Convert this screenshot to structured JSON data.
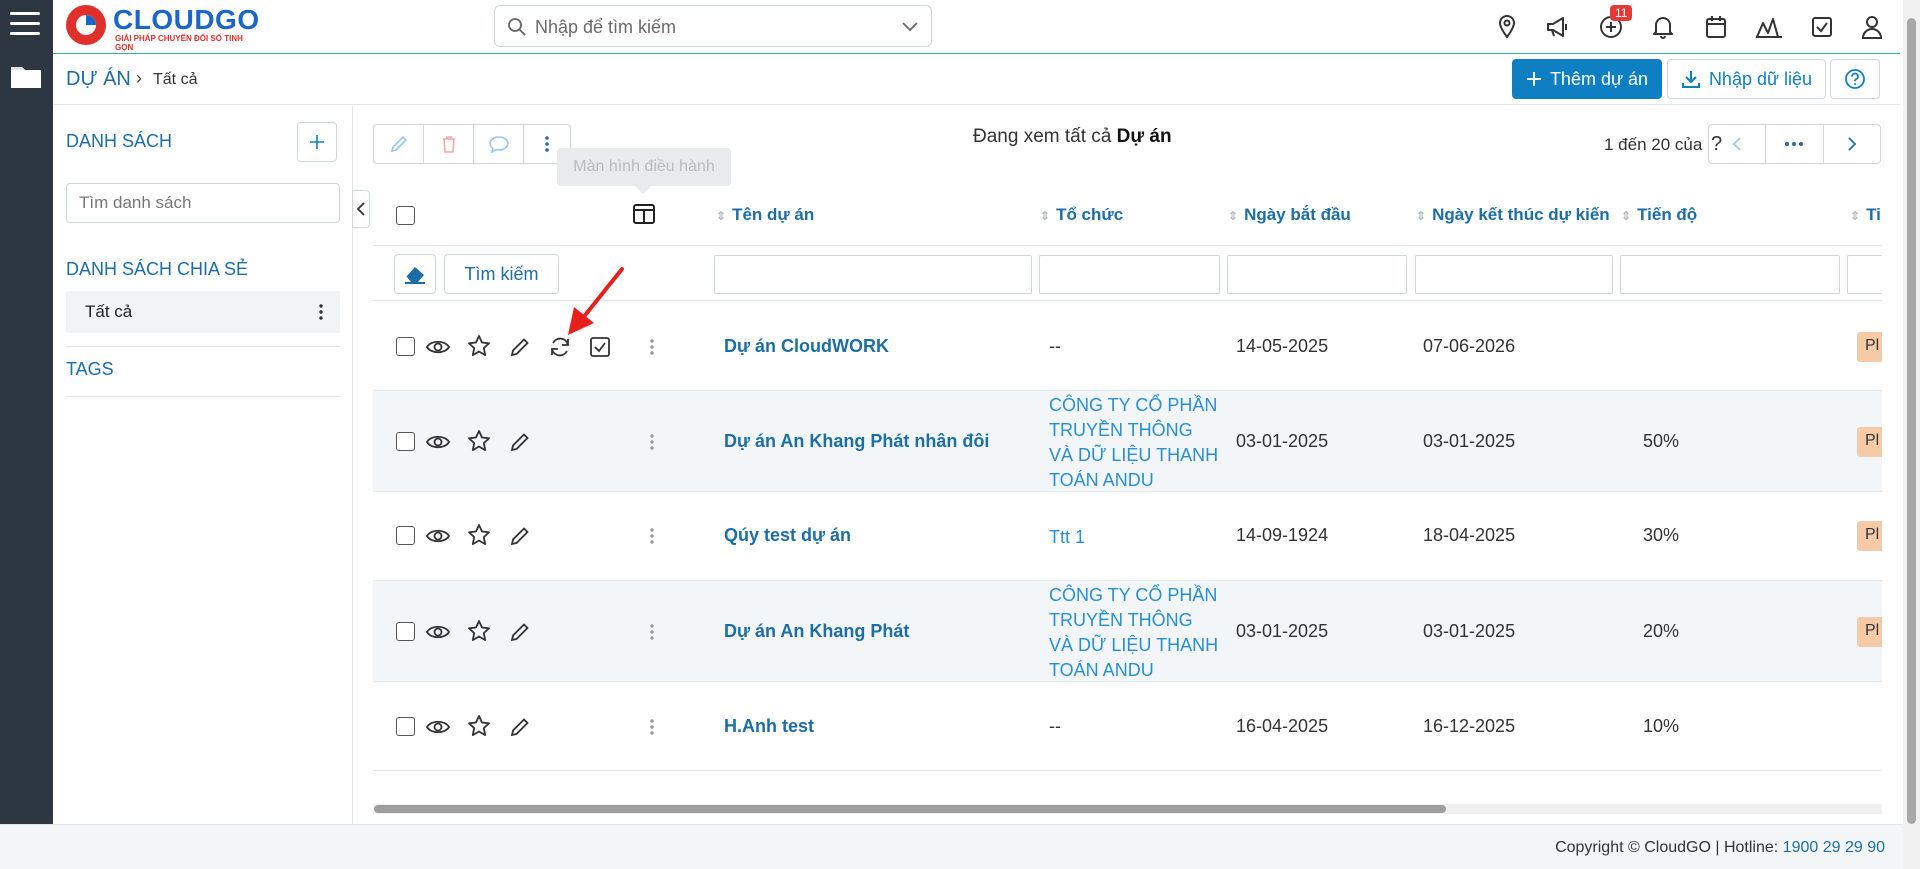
{
  "brand": {
    "name": "CLOUDGO",
    "tagline": "GIẢI PHÁP CHUYỂN ĐỔI SỐ TINH GỌN"
  },
  "search": {
    "placeholder": "Nhập để tìm kiếm"
  },
  "notifications": {
    "count": "11"
  },
  "breadcrumb": {
    "module": "DỰ ÁN",
    "separator": "›",
    "current": "Tất cả"
  },
  "actions": {
    "add_project": "Thêm dự án",
    "import_data": "Nhập dữ liệu"
  },
  "sidebar": {
    "list_title": "DANH SÁCH",
    "search_placeholder": "Tìm danh sách",
    "shared_title": "DANH SÁCH CHIA SẺ",
    "shared_items": [
      {
        "label": "Tất cả"
      }
    ],
    "tags_title": "TAGS"
  },
  "toolbar": {
    "tooltip": "Màn hình điều hành"
  },
  "view": {
    "prefix": "Đang xem tất cả",
    "entity": "Dự án"
  },
  "pagination": {
    "range": "1 đến 20 của",
    "unknown_total": "?"
  },
  "table": {
    "columns": [
      "Tên dự án",
      "Tổ chức",
      "Ngày bắt đầu",
      "Ngày kết thúc dự kiến",
      "Tiến độ",
      "Ti"
    ],
    "filter_button": "Tìm kiếm",
    "rows": [
      {
        "name": "Dự án CloudWORK",
        "org": "--",
        "start": "14-05-2025",
        "end": "07-06-2026",
        "progress": "",
        "status": "Pl"
      },
      {
        "name": "Dự án An Khang Phát nhân đôi",
        "org": "CÔNG TY CỔ PHẦN TRUYỀN THÔNG VÀ DỮ LIỆU THANH TOÁN ANDU",
        "start": "03-01-2025",
        "end": "03-01-2025",
        "progress": "50%",
        "status": "Pl"
      },
      {
        "name": "Qúy test dự án",
        "org": "Ttt 1",
        "start": "14-09-1924",
        "end": "18-04-2025",
        "progress": "30%",
        "status": "Pl"
      },
      {
        "name": "Dự án An Khang Phát",
        "org": "CÔNG TY CỔ PHẦN TRUYỀN THÔNG VÀ DỮ LIỆU THANH TOÁN ANDU",
        "start": "03-01-2025",
        "end": "03-01-2025",
        "progress": "20%",
        "status": "Pl"
      },
      {
        "name": "H.Anh test",
        "org": "--",
        "start": "16-04-2025",
        "end": "16-12-2025",
        "progress": "10%",
        "status": ""
      }
    ]
  },
  "footer": {
    "copyright": "Copyright © CloudGO | Hotline:",
    "hotline": "1900 29 29 90"
  },
  "colors": {
    "accent": "#0f7fc4",
    "link": "#1d6ea4",
    "rail": "#2c3742",
    "badge": "#e53935",
    "tag": "#f5cba7"
  },
  "icons": [
    "menu-icon",
    "folder-icon",
    "search-icon",
    "chevron-down-icon",
    "location-icon",
    "megaphone-icon",
    "plus-circle-icon",
    "bell-icon",
    "calendar-icon",
    "chart-icon",
    "checkbox-icon",
    "user-icon",
    "plus-icon",
    "upload-icon",
    "help-icon",
    "pencil-icon",
    "trash-icon",
    "comment-icon",
    "kebab-icon",
    "columns-icon",
    "eraser-icon",
    "eye-icon",
    "star-icon",
    "refresh-icon",
    "check-square-icon",
    "chevron-left-icon",
    "chevron-right-icon",
    "more-icon"
  ]
}
